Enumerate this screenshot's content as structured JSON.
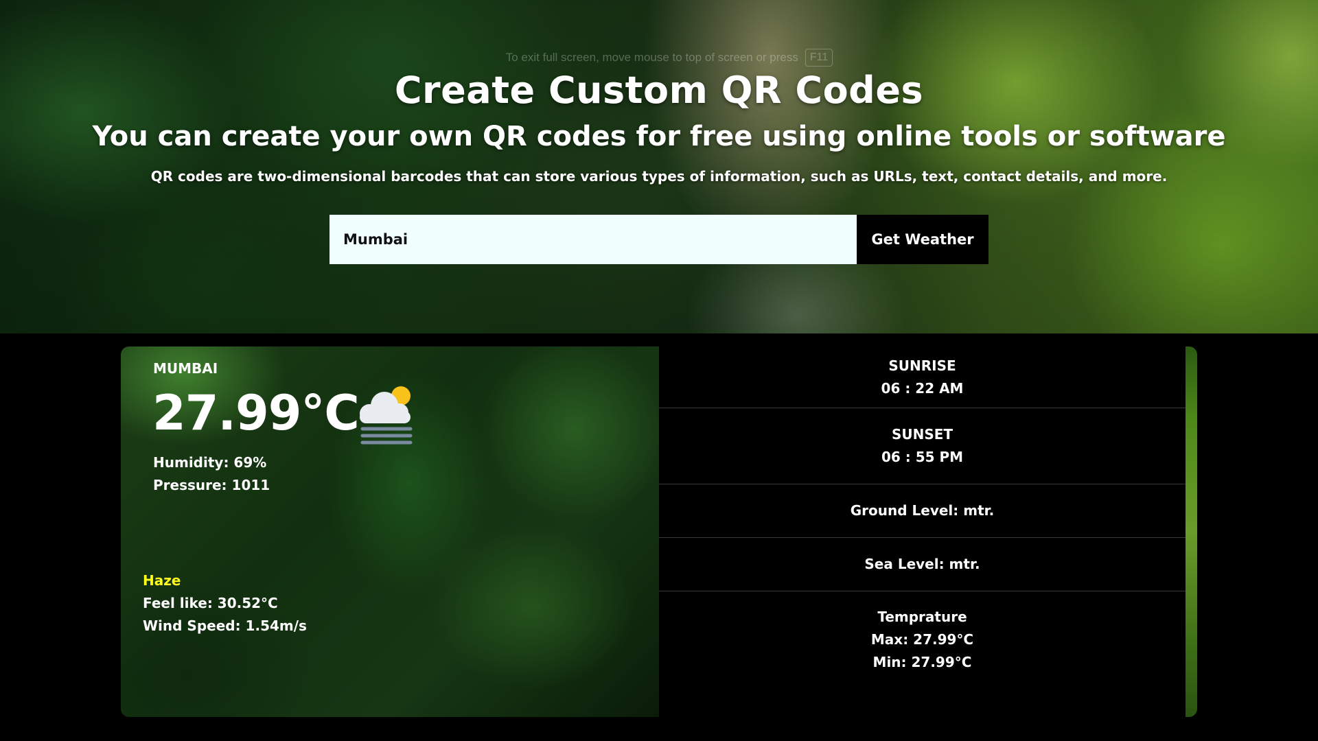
{
  "hero": {
    "fullscreen_hint": "To exit full screen, move mouse to top of screen or press",
    "fullscreen_key": "F11",
    "title": "Create Custom QR Codes",
    "subtitle": "You can create your own QR codes for free using online tools or software",
    "description": "QR codes are two-dimensional barcodes that can store various types of information, such as URLs, text, contact details, and more."
  },
  "search": {
    "value": "Mumbai",
    "button_label": "Get Weather"
  },
  "weather": {
    "city": "MUMBAI",
    "temperature": "27.99°C",
    "icon": "haze-cloud-sun-icon",
    "humidity": "Humidity: 69%",
    "pressure": "Pressure: 1011",
    "condition": "Haze",
    "feels_like": "Feel like: 30.52°C",
    "wind_speed": "Wind Speed: 1.54m/s"
  },
  "details": {
    "sunrise_label": "SUNRISE",
    "sunrise_time": "06 : 22 AM",
    "sunset_label": "SUNSET",
    "sunset_time": "06 : 55 PM",
    "ground_level": "Ground Level: mtr.",
    "sea_level": "Sea Level: mtr.",
    "temp_label": "Temprature",
    "temp_max": "Max: 27.99°C",
    "temp_min": "Min: 27.99°C"
  },
  "colors": {
    "condition_label": "#ffff1a",
    "input_bg": "#f2ffff",
    "button_bg": "#000000"
  }
}
